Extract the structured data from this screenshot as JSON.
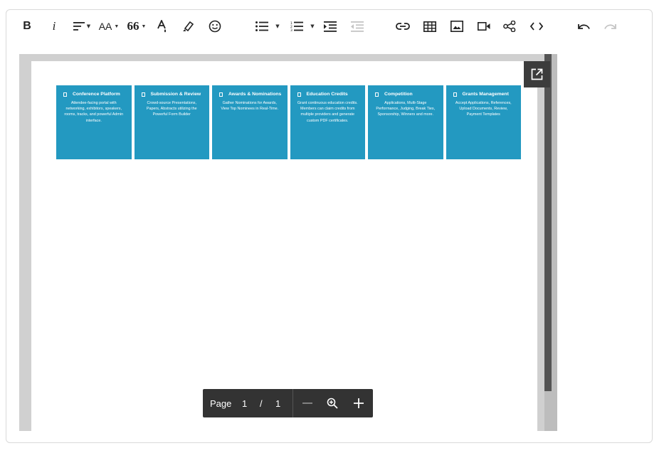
{
  "toolbar": {
    "bold_label": "B",
    "italic_label": "i",
    "fontsize_label": "AA",
    "quote_label": "66"
  },
  "tiles": [
    {
      "title": "Conference Platform",
      "desc": "Attendee-facing portal with networking, exhibitors, speakers, rooms, tracks, and powerful Admin interface."
    },
    {
      "title": "Submission & Review",
      "desc": "Crowd-source Presentations, Papers, Abstracts utilizing the Powerful Form Builder"
    },
    {
      "title": "Awards & Nominations",
      "desc": "Gather Nominations for Awards, View Top Nominees in Real-Time."
    },
    {
      "title": "Education Credits",
      "desc": "Grant continuous education credits. Members can claim credits from multiple providers and generate custom PDF certificates."
    },
    {
      "title": "Competition",
      "desc": "Applications, Multi-Stage Performance, Judging, Break Ties, Sponsorship, Winners and more."
    },
    {
      "title": "Grants Management",
      "desc": "Accept Applications, References, Upload Documents, Review, Payment Templates"
    }
  ],
  "pager": {
    "page_label": "Page",
    "current_page": "1",
    "separator": "/",
    "total_pages": "1"
  },
  "colors": {
    "tile": "#2399c1",
    "pager_bg": "#333333"
  }
}
